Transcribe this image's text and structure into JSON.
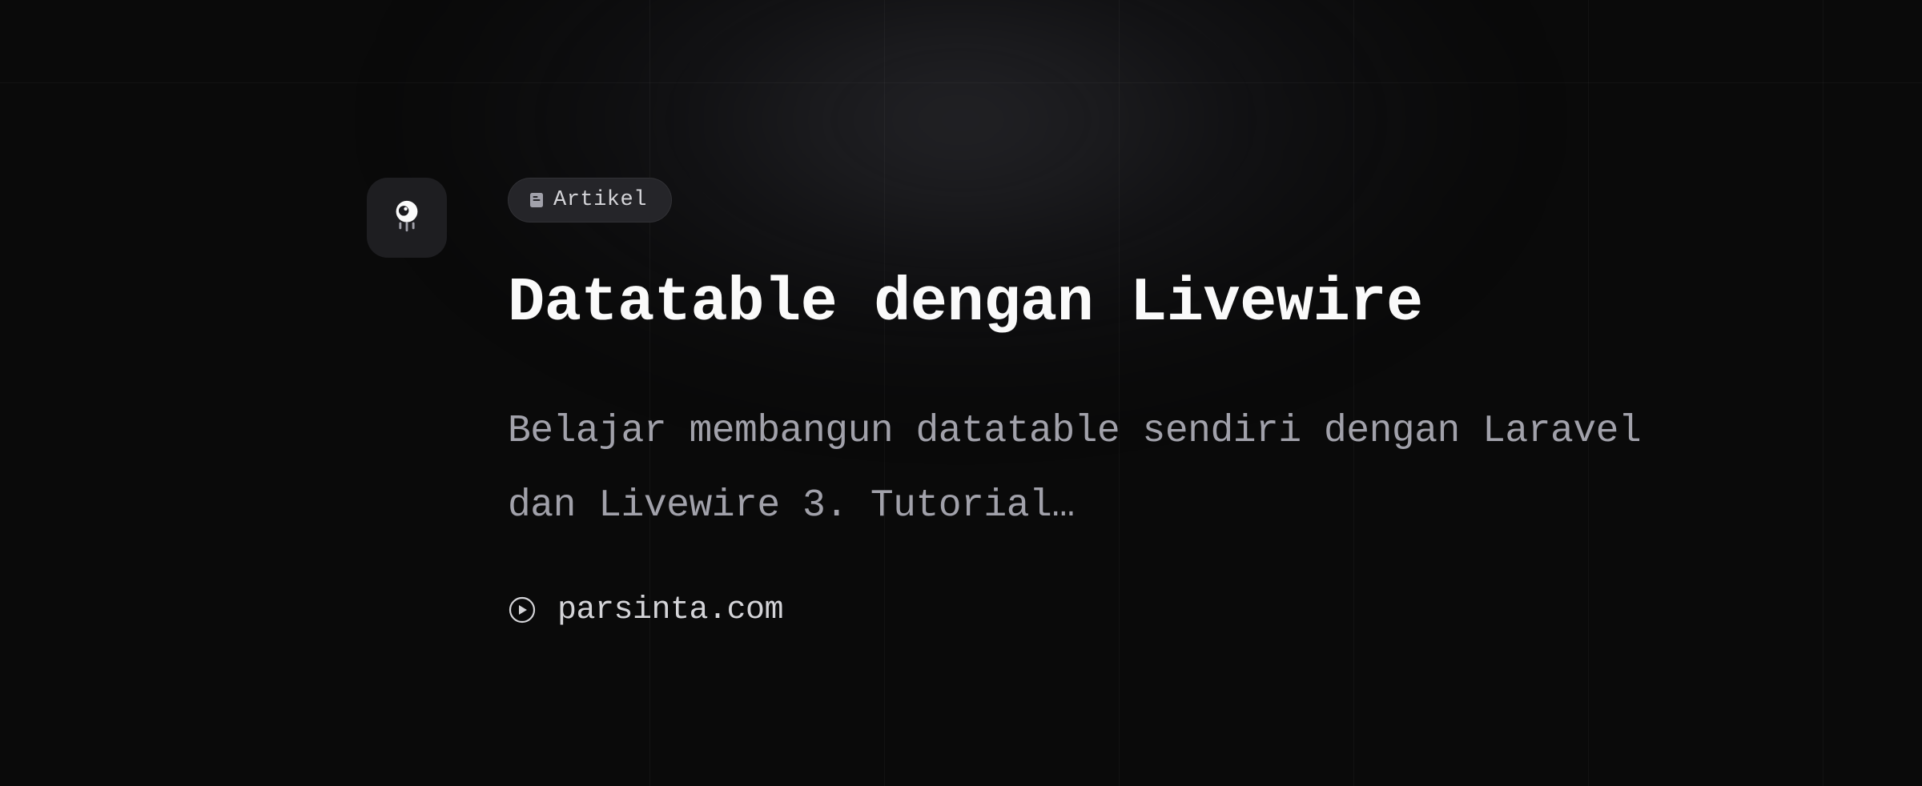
{
  "category": {
    "label": "Artikel",
    "icon": "document-icon"
  },
  "title": "Datatable dengan Livewire",
  "description": "Belajar membangun datatable sendiri dengan Laravel dan Livewire 3. Tutorial…",
  "source": {
    "label": "parsinta.com",
    "icon": "play-circle-icon"
  },
  "colors": {
    "background": "#0a0a0a",
    "title": "#fafafa",
    "description": "#a1a1aa",
    "pill_bg": "#252529",
    "logo_bg": "#1e1e21"
  }
}
